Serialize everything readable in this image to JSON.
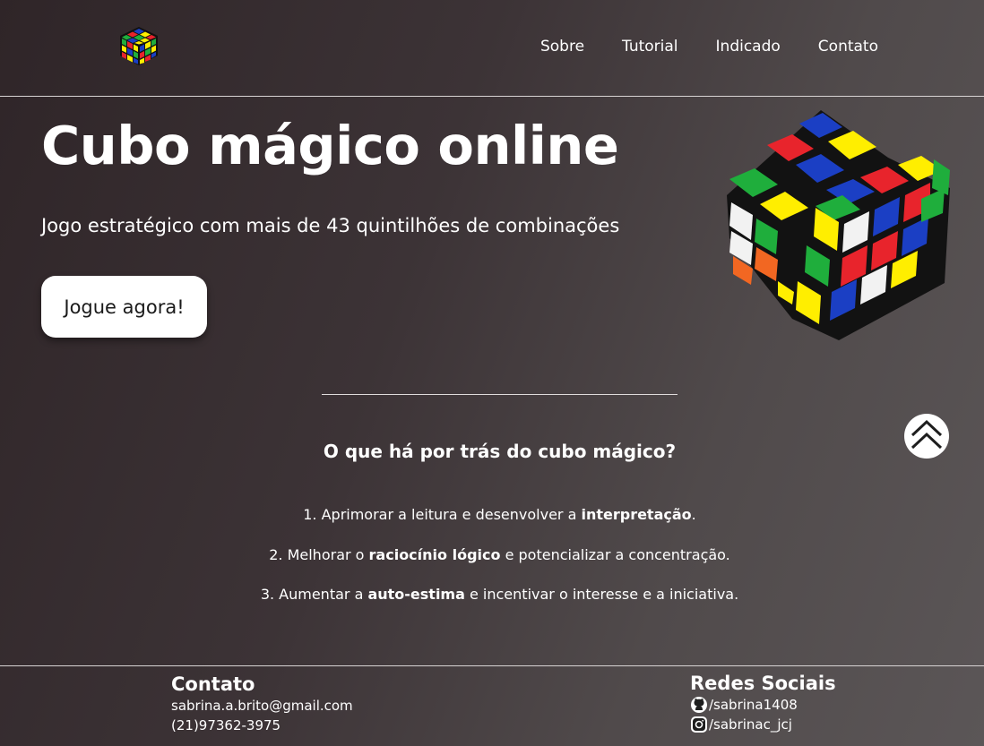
{
  "nav": {
    "links": [
      "Sobre",
      "Tutorial",
      "Indicado",
      "Contato"
    ]
  },
  "hero": {
    "title": "Cubo mágico online",
    "subtitle": "Jogo estratégico com mais de 43 quintilhões de combinações",
    "cta_label": "Jogue agora!"
  },
  "about": {
    "title": "O que há por trás do cubo mágico?",
    "items": [
      {
        "prefix": "1. Aprimorar a leitura e desenvolver a ",
        "bold": "interpretação",
        "suffix": "."
      },
      {
        "prefix": "2. Melhorar o ",
        "bold": "raciocínio lógico",
        "suffix": " e potencializar a concentração."
      },
      {
        "prefix": "3. Aumentar a ",
        "bold": "auto-estima",
        "suffix": " e incentivar o interesse e a iniciativa."
      }
    ]
  },
  "footer": {
    "contact": {
      "title": "Contato",
      "email": "sabrina.a.brito@gmail.com",
      "phone": "(21)97362-3975"
    },
    "social": {
      "title": "Redes Sociais",
      "github": "/sabrina1408",
      "instagram": "/sabrinac_jcj"
    }
  },
  "icons": {
    "logo": "rubiks-cube-logo",
    "hero_image": "rubiks-cube-image",
    "scroll_top": "double-chevron-up-icon",
    "github": "github-icon",
    "instagram": "instagram-icon"
  },
  "colors": {
    "cube_white": "#f2f2f2",
    "cube_yellow": "#ffee00",
    "cube_red": "#e8242c",
    "cube_blue": "#1b3fc4",
    "cube_green": "#1fae3c",
    "cube_orange": "#f26722"
  }
}
